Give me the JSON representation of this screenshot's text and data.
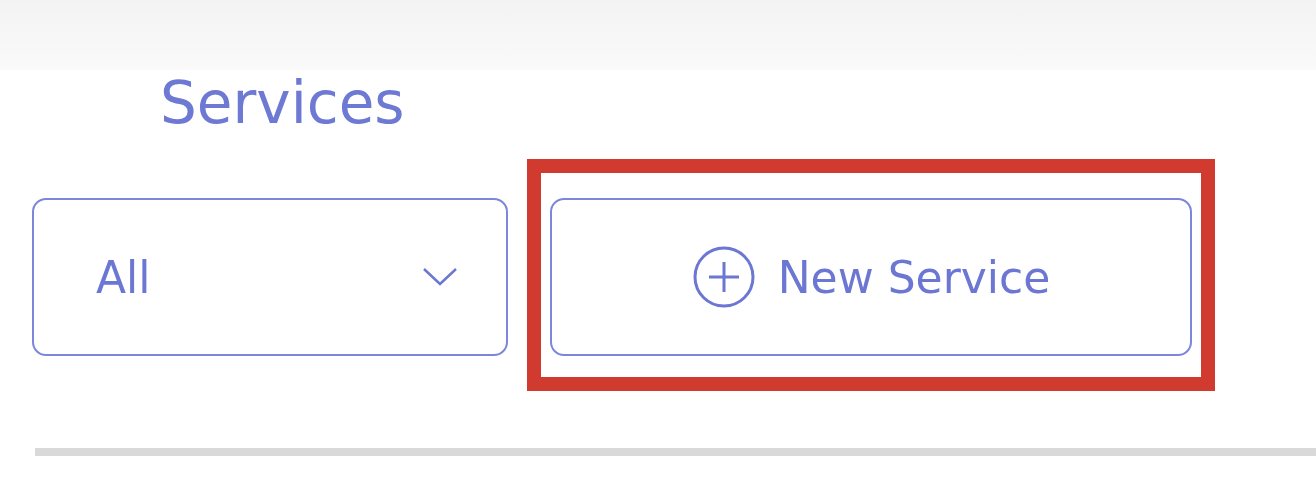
{
  "page": {
    "title": "Services"
  },
  "filter": {
    "value": "All"
  },
  "new_button": {
    "label": "New Service",
    "highlighted": true
  }
}
